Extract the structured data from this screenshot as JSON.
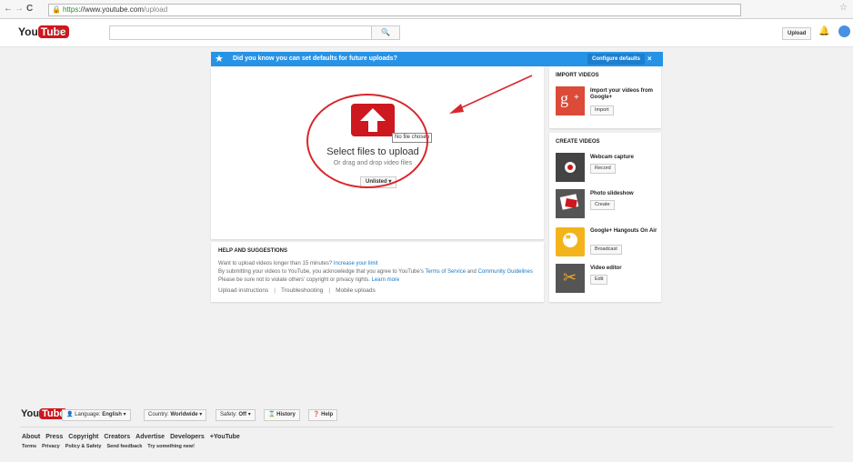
{
  "browser": {
    "url_scheme": "https",
    "url_host": "://www.youtube.com",
    "url_path": "/upload"
  },
  "masthead": {
    "logo_you": "You",
    "logo_tube": "Tube",
    "upload_label": "Upload"
  },
  "banner": {
    "text": "Did you know you can set defaults for future uploads?",
    "configure_label": "Configure defaults",
    "close": "×"
  },
  "upload": {
    "tooltip": "No file chosen",
    "select_files": "Select files to upload",
    "drag_drop": "Or drag and drop video files",
    "privacy": "Unlisted"
  },
  "help": {
    "title": "HELP AND SUGGESTIONS",
    "line1": "Want to upload videos longer than 15 minutes?",
    "line1_link": "Increase your limit",
    "line2_pre": "By submitting your videos to YouTube, you acknowledge that you agree to YouTube's",
    "tos": "Terms of Service",
    "and": "and",
    "guidelines": "Community Guidelines",
    "line3": "Please be sure not to violate others' copyright or privacy rights.",
    "learn_more": "Learn more",
    "link_instructions": "Upload instructions",
    "link_troubleshooting": "Troubleshooting",
    "link_mobile": "Mobile uploads"
  },
  "import_videos": {
    "title": "IMPORT VIDEOS",
    "item_title": "Import your videos from Google+",
    "item_button": "Import"
  },
  "create_videos": {
    "title": "CREATE VIDEOS",
    "items": [
      {
        "title": "Webcam capture",
        "button": "Record"
      },
      {
        "title": "Photo slideshow",
        "button": "Create"
      },
      {
        "title": "Google+ Hangouts On Air",
        "button": "Broadcast"
      },
      {
        "title": "Video editor",
        "button": "Edit"
      }
    ]
  },
  "footer": {
    "language_label": "Language:",
    "language_value": "English",
    "country_label": "Country:",
    "country_value": "Worldwide",
    "safety_label": "Safety:",
    "safety_value": "Off",
    "history": "History",
    "help": "Help",
    "primary_links": [
      "About",
      "Press",
      "Copyright",
      "Creators",
      "Advertise",
      "Developers",
      "+YouTube"
    ],
    "secondary_links": [
      "Terms",
      "Privacy",
      "Policy & Safety",
      "Send feedback",
      "Try something new!"
    ]
  },
  "colors": {
    "brand_red": "#cc181e",
    "banner_blue": "#2793e6",
    "link_blue": "#167ac6",
    "annotation_red": "#d9262c"
  }
}
